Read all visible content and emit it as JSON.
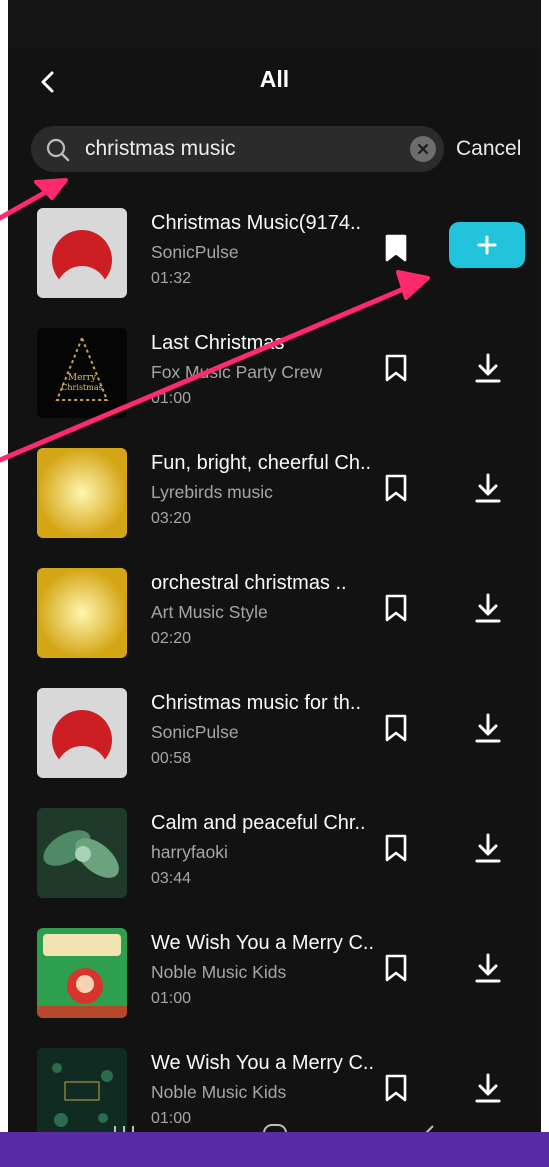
{
  "header": {
    "title": "All"
  },
  "search": {
    "value": "christmas music"
  },
  "actions": {
    "cancel_label": "Cancel"
  },
  "colors": {
    "accent": "#22c3dd",
    "annotation": "#ff2a6e",
    "background": "#121212"
  },
  "icons": {
    "back": "chevron-left-icon",
    "search": "magnifier-icon",
    "clear": "close-circle-icon",
    "bookmark": "bookmark-icon",
    "download": "download-icon",
    "add": "plus-icon"
  },
  "tracks": [
    {
      "title": "Christmas Music(9174..",
      "artist": "SonicPulse",
      "duration": "01:32",
      "bookmarked": true,
      "action": "use"
    },
    {
      "title": "Last Christmas",
      "artist": "Fox Music Party Crew",
      "duration": "01:00",
      "bookmarked": false,
      "action": "download"
    },
    {
      "title": "Fun, bright, cheerful Ch..",
      "artist": "Lyrebirds music",
      "duration": "03:20",
      "bookmarked": false,
      "action": "download"
    },
    {
      "title": "orchestral christmas ..",
      "artist": "Art Music Style",
      "duration": "02:20",
      "bookmarked": false,
      "action": "download"
    },
    {
      "title": "Christmas music for th..",
      "artist": "SonicPulse",
      "duration": "00:58",
      "bookmarked": false,
      "action": "download"
    },
    {
      "title": "Calm and peaceful Chr..",
      "artist": "harryfaoki",
      "duration": "03:44",
      "bookmarked": false,
      "action": "download"
    },
    {
      "title": "We Wish You a Merry C..",
      "artist": "Noble Music Kids",
      "duration": "01:00",
      "bookmarked": false,
      "action": "download"
    },
    {
      "title": "We Wish You a Merry C..",
      "artist": "Noble Music Kids",
      "duration": "01:00",
      "bookmarked": false,
      "action": "download"
    }
  ]
}
